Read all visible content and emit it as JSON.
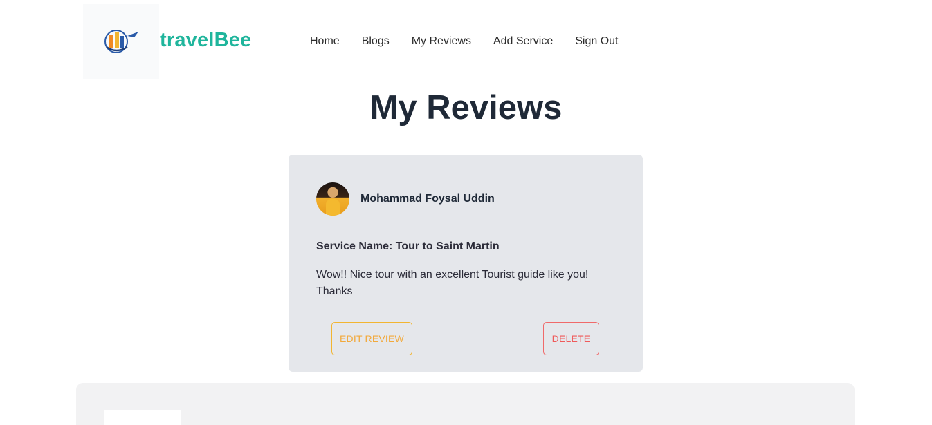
{
  "brand": {
    "name": "travelBee"
  },
  "nav": {
    "items": [
      {
        "label": "Home"
      },
      {
        "label": "Blogs"
      },
      {
        "label": "My Reviews"
      },
      {
        "label": "Add Service"
      },
      {
        "label": "Sign Out"
      }
    ]
  },
  "page": {
    "title": "My Reviews"
  },
  "review": {
    "reviewer_name": "Mohammad Foysal Uddin",
    "service_name": "Service Name: Tour to Saint Martin",
    "text": "Wow!! Nice tour with an excellent Tourist guide like you! Thanks",
    "edit_label": "EDIT REVIEW",
    "delete_label": "DELETE"
  },
  "colors": {
    "brand": "#1fb59c",
    "card_bg": "#e5e7eb",
    "edit_accent": "#f2b531",
    "delete_accent": "#ef5a5a"
  }
}
